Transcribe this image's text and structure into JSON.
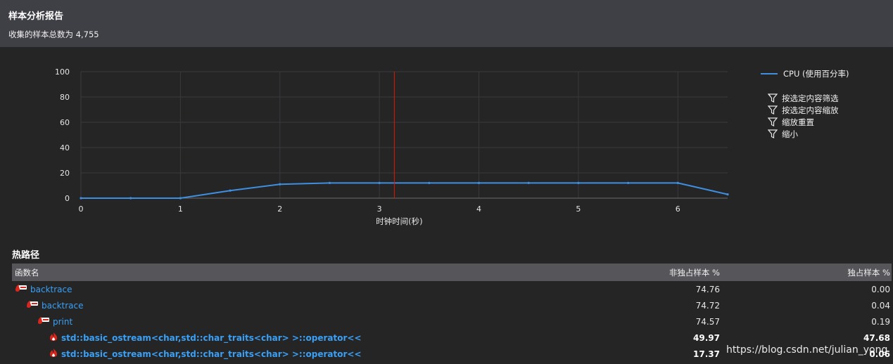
{
  "header": {
    "title": "样本分析报告",
    "subtitle": "收集的样本总数为 4,755"
  },
  "chart_data": {
    "type": "line",
    "xlabel": "时钟时间(秒)",
    "ylabel": "",
    "xlim": [
      0,
      6.5
    ],
    "ylim": [
      0,
      100
    ],
    "x_ticks": [
      "0",
      "1",
      "2",
      "3",
      "4",
      "5",
      "6"
    ],
    "y_ticks": [
      "0",
      "20",
      "40",
      "60",
      "80",
      "100"
    ],
    "grid": true,
    "series": [
      {
        "name": "CPU (使用百分率)",
        "color": "#3f8fe0",
        "x": [
          0,
          0.5,
          1,
          1.5,
          2,
          2.5,
          3,
          3.5,
          4,
          4.5,
          5,
          5.5,
          6,
          6.5
        ],
        "y": [
          0,
          0,
          0,
          6,
          11,
          12,
          12,
          12,
          12,
          12,
          12,
          12,
          12,
          3
        ]
      }
    ],
    "marker_line_x": 3.15,
    "marker_line_color": "#e51400",
    "legend_position": "right"
  },
  "legend": {
    "series_label": "CPU (使用百分率)",
    "actions": [
      {
        "label": "按选定内容筛选",
        "icon": "filter-selection-icon"
      },
      {
        "label": "按选定内容缩放",
        "icon": "filter-icon"
      },
      {
        "label": "缩放重置",
        "icon": "filter-icon"
      },
      {
        "label": "缩小",
        "icon": "filter-icon"
      }
    ]
  },
  "hotpath": {
    "title": "热路径",
    "columns": {
      "name": "函数名",
      "inclusive": "非独占样本 %",
      "exclusive": "独占样本 %"
    },
    "rows": [
      {
        "name": "backtrace",
        "indent": 0,
        "icon": "hot-path-icon",
        "inclusive": "74.76",
        "exclusive": "0.00",
        "bold": false
      },
      {
        "name": "backtrace",
        "indent": 1,
        "icon": "hot-path-icon",
        "inclusive": "74.72",
        "exclusive": "0.04",
        "bold": false
      },
      {
        "name": "print",
        "indent": 2,
        "icon": "hot-path-icon",
        "inclusive": "74.57",
        "exclusive": "0.19",
        "bold": false
      },
      {
        "name": "std::basic_ostream<char,std::char_traits<char> >::operator<<",
        "indent": 3,
        "icon": "flame-icon",
        "inclusive": "49.97",
        "exclusive": "47.68",
        "bold": true
      },
      {
        "name": "std::basic_ostream<char,std::char_traits<char> >::operator<<",
        "indent": 3,
        "icon": "flame-icon",
        "inclusive": "17.37",
        "exclusive": "0.06",
        "bold": true
      }
    ]
  },
  "watermark": "https://blog.csdn.net/julian_yong"
}
